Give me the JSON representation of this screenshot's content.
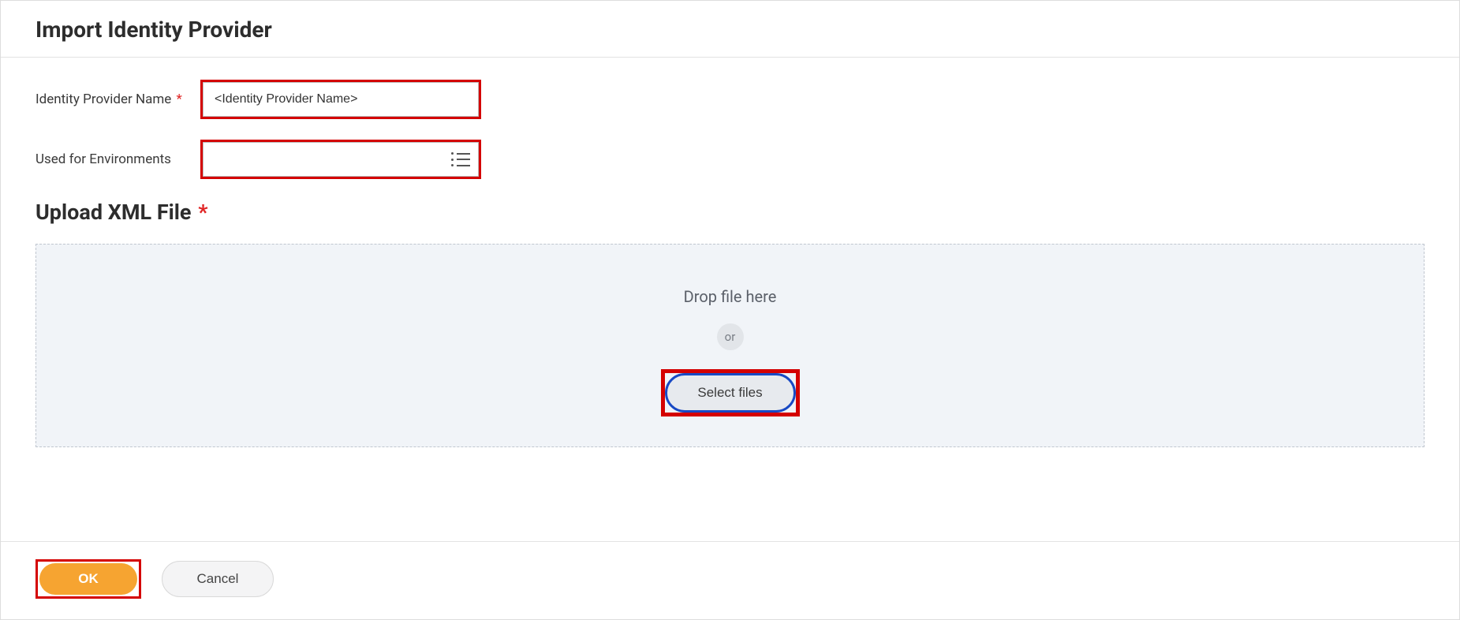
{
  "header": {
    "title": "Import Identity Provider"
  },
  "form": {
    "name_label": "Identity Provider Name",
    "name_value": "<Identity Provider Name>",
    "env_label": "Used for Environments",
    "env_value": ""
  },
  "upload": {
    "section_title": "Upload XML File",
    "drop_text": "Drop file here",
    "or_text": "or",
    "select_label": "Select files"
  },
  "footer": {
    "ok_label": "OK",
    "cancel_label": "Cancel"
  }
}
